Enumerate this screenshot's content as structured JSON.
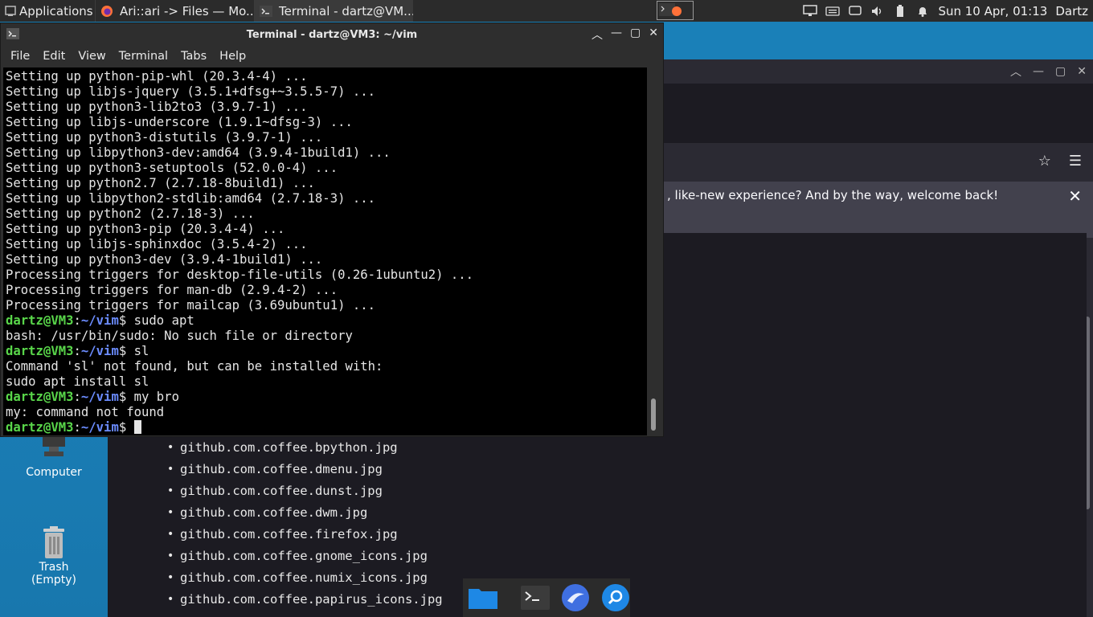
{
  "top_panel": {
    "apps_label": "Applications",
    "tasks": [
      {
        "label": "Ari::ari -> Files — Mo...",
        "icon": "firefox-icon"
      },
      {
        "label": "Terminal - dartz@VM...",
        "icon": "terminal-icon"
      }
    ],
    "clock": "Sun 10 Apr, 01:13",
    "user": "Dartz"
  },
  "terminal": {
    "title": "Terminal - dartz@VM3: ~/vim",
    "menu": [
      "File",
      "Edit",
      "View",
      "Terminal",
      "Tabs",
      "Help"
    ],
    "lines": [
      {
        "type": "out",
        "text": "Setting up python-pip-whl (20.3.4-4) ..."
      },
      {
        "type": "out",
        "text": "Setting up libjs-jquery (3.5.1+dfsg+~3.5.5-7) ..."
      },
      {
        "type": "out",
        "text": "Setting up python3-lib2to3 (3.9.7-1) ..."
      },
      {
        "type": "out",
        "text": "Setting up libjs-underscore (1.9.1~dfsg-3) ..."
      },
      {
        "type": "out",
        "text": "Setting up python3-distutils (3.9.7-1) ..."
      },
      {
        "type": "out",
        "text": "Setting up libpython3-dev:amd64 (3.9.4-1build1) ..."
      },
      {
        "type": "out",
        "text": "Setting up python3-setuptools (52.0.0-4) ..."
      },
      {
        "type": "out",
        "text": "Setting up python2.7 (2.7.18-8build1) ..."
      },
      {
        "type": "out",
        "text": "Setting up libpython2-stdlib:amd64 (2.7.18-3) ..."
      },
      {
        "type": "out",
        "text": "Setting up python2 (2.7.18-3) ..."
      },
      {
        "type": "out",
        "text": "Setting up python3-pip (20.3.4-4) ..."
      },
      {
        "type": "out",
        "text": "Setting up libjs-sphinxdoc (3.5.4-2) ..."
      },
      {
        "type": "out",
        "text": "Setting up python3-dev (3.9.4-1build1) ..."
      },
      {
        "type": "out",
        "text": "Processing triggers for desktop-file-utils (0.26-1ubuntu2) ..."
      },
      {
        "type": "out",
        "text": "Processing triggers for man-db (2.9.4-2) ..."
      },
      {
        "type": "out",
        "text": "Processing triggers for mailcap (3.69ubuntu1) ..."
      },
      {
        "type": "cmd",
        "cmd": "sudo apt"
      },
      {
        "type": "out",
        "text": "bash: /usr/bin/sudo: No such file or directory"
      },
      {
        "type": "cmd",
        "cmd": "sl"
      },
      {
        "type": "out",
        "text": "Command 'sl' not found, but can be installed with:"
      },
      {
        "type": "out",
        "text": "sudo apt install sl"
      },
      {
        "type": "cmd",
        "cmd": "my bro"
      },
      {
        "type": "out",
        "text": "my: command not found"
      },
      {
        "type": "cmd",
        "cmd": "",
        "cursor": true
      }
    ],
    "prompt_user": "dartz@VM3",
    "prompt_sep": ":",
    "prompt_path": "~/vim",
    "prompt_end": "$ "
  },
  "browser": {
    "notice_text": ", like-new experience? And by the way, welcome back!",
    "close_glyph": "✕"
  },
  "files": [
    "github.com.coffee.bpython.jpg",
    "github.com.coffee.dmenu.jpg",
    "github.com.coffee.dunst.jpg",
    "github.com.coffee.dwm.jpg",
    "github.com.coffee.firefox.jpg",
    "github.com.coffee.gnome_icons.jpg",
    "github.com.coffee.numix_icons.jpg",
    "github.com.coffee.papirus_icons.jpg"
  ],
  "desktop_icons": [
    {
      "label": "Computer",
      "icon": "computer-icon"
    },
    {
      "label": "Trash",
      "sublabel": "(Empty)",
      "icon": "trash-icon"
    }
  ],
  "dock": [
    "files-icon",
    "terminal-icon",
    "browser-icon",
    "search-icon"
  ],
  "colors": {
    "prompt_user": "#59d64a",
    "prompt_path": "#6b8cff",
    "panel": "#2b2b2b"
  }
}
